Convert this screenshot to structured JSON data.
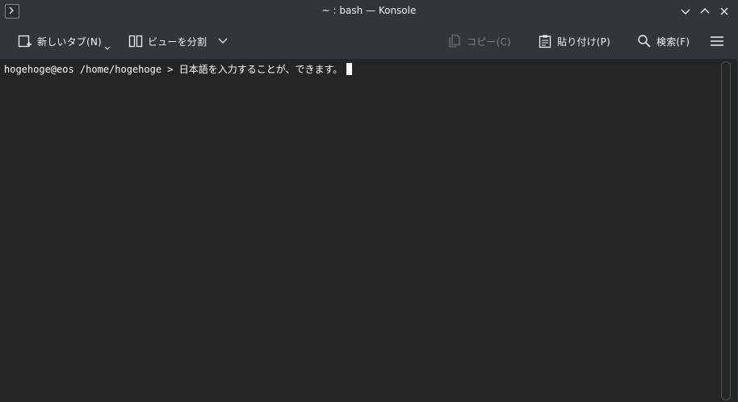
{
  "window": {
    "title": "~ : bash — Konsole"
  },
  "toolbar": {
    "new_tab_label": "新しいタブ(N)",
    "split_view_label": "ビューを分割",
    "copy_label": "コピー(C)",
    "paste_label": "貼り付け(P)",
    "find_label": "検索(F)"
  },
  "terminal": {
    "prompt": "hogehoge@eos /home/hogehoge >",
    "input": "日本語を入力することが、できます。"
  },
  "colors": {
    "titlebar_bg": "#31363b",
    "terminal_bg": "#232627",
    "text": "#fcfcfc",
    "disabled_text": "#7a8085"
  },
  "icons": [
    "terminal-app-icon",
    "new-tab-icon",
    "split-view-icon",
    "chevron-down-icon",
    "copy-icon",
    "paste-icon",
    "search-icon",
    "hamburger-menu-icon",
    "minimize-icon",
    "maximize-icon",
    "close-icon"
  ]
}
